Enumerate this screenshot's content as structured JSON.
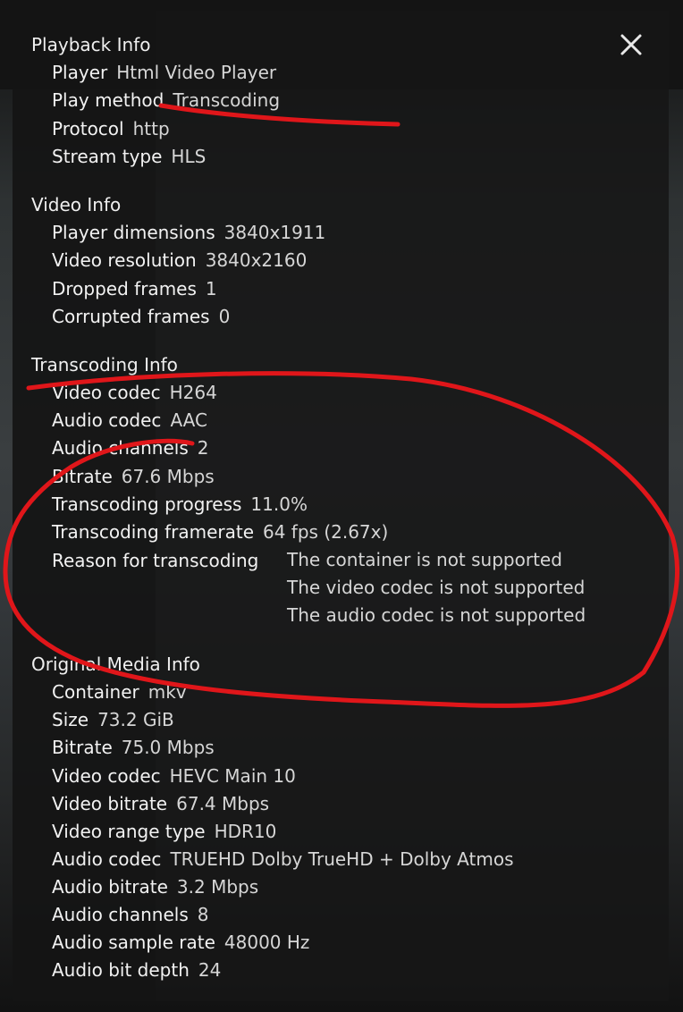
{
  "colors": {
    "annotation": "#e0161a",
    "panel_bg": "#161616",
    "text": "#e9e9e9"
  },
  "close_icon": "close-icon",
  "sections": {
    "playback": {
      "title": "Playback Info",
      "rows": [
        {
          "label": "Player",
          "value": "Html Video Player"
        },
        {
          "label": "Play method",
          "value": "Transcoding"
        },
        {
          "label": "Protocol",
          "value": "http"
        },
        {
          "label": "Stream type",
          "value": "HLS"
        }
      ]
    },
    "video": {
      "title": "Video Info",
      "rows": [
        {
          "label": "Player dimensions",
          "value": "3840x1911"
        },
        {
          "label": "Video resolution",
          "value": "3840x2160"
        },
        {
          "label": "Dropped frames",
          "value": "1"
        },
        {
          "label": "Corrupted frames",
          "value": "0"
        }
      ]
    },
    "transcoding": {
      "title": "Transcoding Info",
      "rows": [
        {
          "label": "Video codec",
          "value": "H264"
        },
        {
          "label": "Audio codec",
          "value": "AAC"
        },
        {
          "label": "Audio channels",
          "value": "2"
        },
        {
          "label": "Bitrate",
          "value": "67.6 Mbps"
        },
        {
          "label": "Transcoding progress",
          "value": "11.0%"
        },
        {
          "label": "Transcoding framerate",
          "value": "64 fps (2.67x)"
        }
      ],
      "reason_label": "Reason for transcoding",
      "reasons": [
        "The container is not supported",
        "The video codec is not supported",
        "The audio codec is not supported"
      ]
    },
    "original": {
      "title": "Original Media Info",
      "rows": [
        {
          "label": "Container",
          "value": "mkv"
        },
        {
          "label": "Size",
          "value": "73.2 GiB"
        },
        {
          "label": "Bitrate",
          "value": "75.0 Mbps"
        },
        {
          "label": "Video codec",
          "value": "HEVC Main 10"
        },
        {
          "label": "Video bitrate",
          "value": "67.4 Mbps"
        },
        {
          "label": "Video range type",
          "value": "HDR10"
        },
        {
          "label": "Audio codec",
          "value": "TRUEHD Dolby TrueHD + Dolby Atmos"
        },
        {
          "label": "Audio bitrate",
          "value": "3.2 Mbps"
        },
        {
          "label": "Audio channels",
          "value": "8"
        },
        {
          "label": "Audio sample rate",
          "value": "48000 Hz"
        },
        {
          "label": "Audio bit depth",
          "value": "24"
        }
      ]
    }
  }
}
